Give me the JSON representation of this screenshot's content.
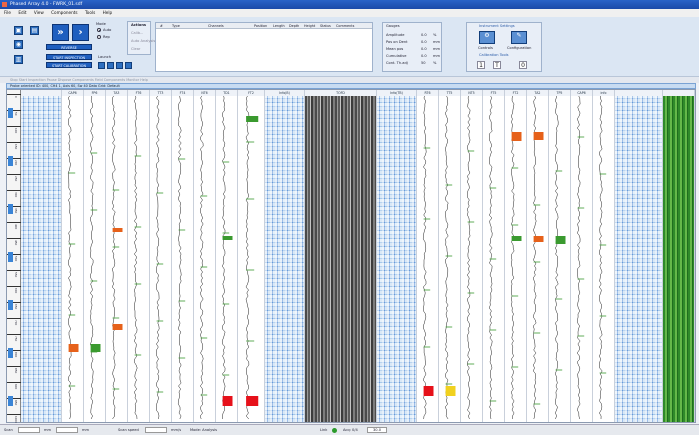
{
  "window": {
    "title": "Phased Array 4.0 - FWRK_01.sdf"
  },
  "menu": [
    "File",
    "Edit",
    "View",
    "Components",
    "Tools",
    "Help"
  ],
  "toolbar": {
    "mode_label": "Mode",
    "mode_auto": "Auto",
    "mode_rep": "Rep",
    "actions_title": "Actions",
    "action_items": [
      "Calib...",
      "Auto Analysis...",
      "Clear"
    ],
    "launch_label": "Launch",
    "btn_reverse": "REVERSE",
    "btn_start_inspection": "START INSPECTION",
    "btn_start_calibration": "START CALIBRATION",
    "table_columns": [
      "#",
      "Type",
      "Channels",
      "Position",
      "Length",
      "Depth",
      "Height",
      "Status",
      "Comments"
    ],
    "gauge_title": "Gauges",
    "gauge_rows": [
      {
        "label": "Amplitude",
        "v1": "0.0",
        "v2": "%"
      },
      {
        "label": "Pos on Dent",
        "v1": "0.0",
        "v2": "mm"
      },
      {
        "label": "Mean pos",
        "v1": "0.0",
        "v2": "mm"
      },
      {
        "label": "Cumulative",
        "v1": "0.0",
        "v2": "mm"
      },
      {
        "label": "Cont. Th.adj",
        "v1": "50",
        "v2": "%"
      }
    ],
    "settings_title": "Instrument Settings",
    "controls_label": "Controls",
    "config_label": "Configuration",
    "calib_label": "Calibration Tools",
    "calib_vals": [
      "1",
      "T",
      "0"
    ]
  },
  "statusrow": "Stop  Start  Inspection  Pause  Dispose  Components  Field  Components  Monitor  Help",
  "infobar": "Probe oriented ID: 400, CH4 1, Axis 60, Sw 40 Data Grid: Default",
  "channels": [
    "CAP6",
    "FP6",
    "TA3",
    "FT6",
    "TT3",
    "FT4",
    "NT6",
    "TD1",
    "FT2",
    "Info(B)",
    "TOFD",
    "Info(TB)",
    "RT6",
    "TT5",
    "NT5",
    "FT5",
    "FT2",
    "TA2",
    "TP5",
    "CAP6",
    "info"
  ],
  "ruler_ticks": [
    "0",
    "50",
    "100",
    "150",
    "200",
    "250",
    "300",
    "350",
    "400",
    "450",
    "500",
    "550",
    "600",
    "650",
    "700",
    "750",
    "800",
    "850",
    "900",
    "950",
    "1000"
  ],
  "footer": {
    "speed_label": "Scan",
    "speed_unit": "mm",
    "step_unit": "mm",
    "scan_speed": "Scan speed",
    "unit_s": "mm/s",
    "mode": "Mode: Analysis",
    "link": "Link",
    "acq": "Acq: 0/4",
    "val": "30.0"
  }
}
